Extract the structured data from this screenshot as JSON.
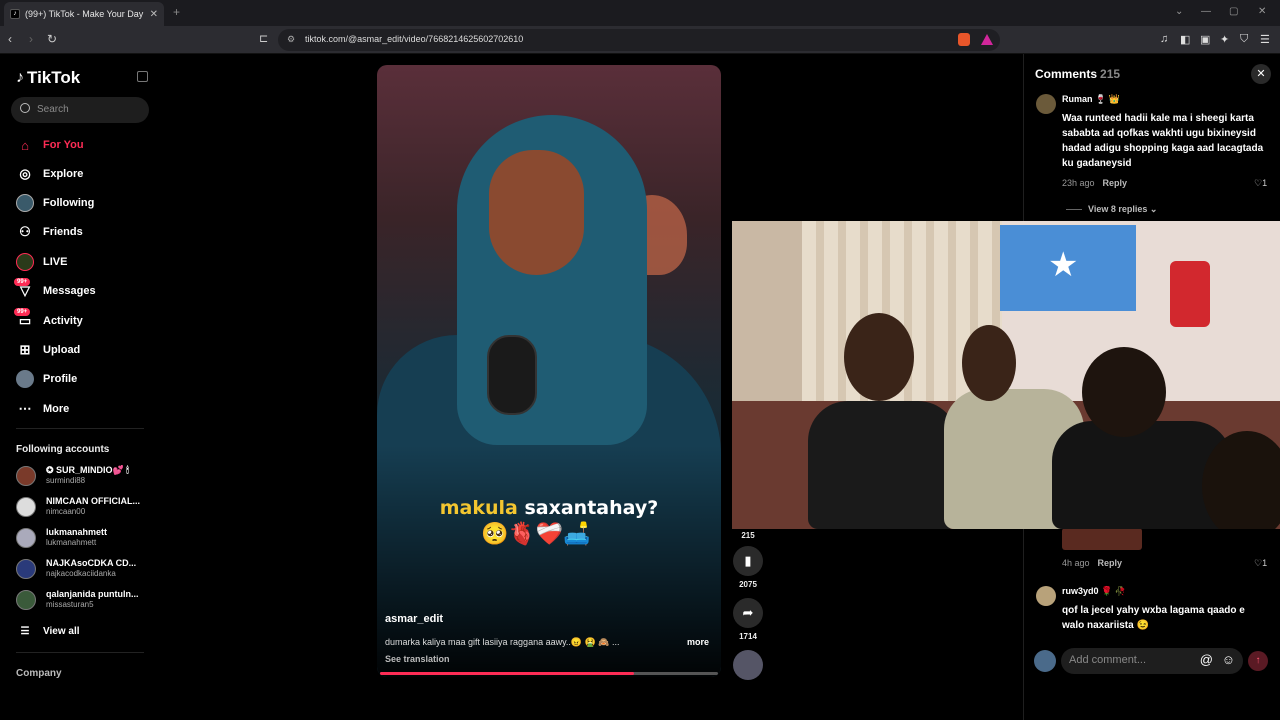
{
  "browser": {
    "tab_title": "(99+) TikTok - Make Your Day",
    "tab_close": "✕",
    "new_tab": "+",
    "url": "tiktok.com/@asmar_edit/video/7668214625602702610"
  },
  "sidebar": {
    "logo": "TikTok",
    "search_placeholder": "Search",
    "nav": [
      {
        "label": "For You"
      },
      {
        "label": "Explore"
      },
      {
        "label": "Following"
      },
      {
        "label": "Friends"
      },
      {
        "label": "LIVE"
      },
      {
        "label": "Messages",
        "badge": "99+"
      },
      {
        "label": "Activity",
        "badge": "99+"
      },
      {
        "label": "Upload"
      },
      {
        "label": "Profile"
      },
      {
        "label": "More"
      }
    ],
    "following_title": "Following accounts",
    "accounts": [
      {
        "name": "✪ SUR_MINDIO💕 🕯",
        "handle": "surmindi88"
      },
      {
        "name": "NIMCAAN OFFICIAL...",
        "handle": "nimcaan00"
      },
      {
        "name": "lukmanahmett",
        "handle": "lukmanahmett"
      },
      {
        "name": "NAJKAsoCDKA CD...",
        "handle": "najkacodkaciidanka"
      },
      {
        "name": "qalanjanida puntuln...",
        "handle": "missasturan5"
      }
    ],
    "view_all": "View all",
    "company": "Company"
  },
  "video": {
    "caption_y": "makula",
    "caption_w": "saxantahay?",
    "emojis": "🥺🫀❤️‍🩹🛋️",
    "username": "asmar_edit",
    "description": "dumarka kaliya maa gift lasiiya raggana aawy..😠 🤮 🙈 ...",
    "more": "more",
    "see_translation": "See translation",
    "progress": 0.75
  },
  "actions": {
    "comment_count": "215",
    "save_count": "2075",
    "share_count": "1714"
  },
  "comments": {
    "title": "Comments",
    "count": "215",
    "items": [
      {
        "user": "Ruman 🍷 👑",
        "text": "Waa runteed hadii kale ma i sheegi karta sababta ad qofkas wakhti ugu bixineysid hadad adigu shopping kaga aad lacagtada ku gadaneysid",
        "time": "23h ago",
        "reply": "Reply",
        "likes": "1"
      },
      {
        "user": "",
        "text": "",
        "time": "4h ago",
        "reply": "Reply",
        "likes": "1"
      },
      {
        "user": "ruw3yd0 🌹 🥀",
        "text": "qof la jecel yahy wxba lagama qaado e walo naxariista 😉",
        "time": "",
        "reply": "",
        "likes": ""
      }
    ],
    "view_replies": "View 8 replies ⌄",
    "add_placeholder": "Add comment...",
    "at": "@",
    "emoji": "☺"
  }
}
